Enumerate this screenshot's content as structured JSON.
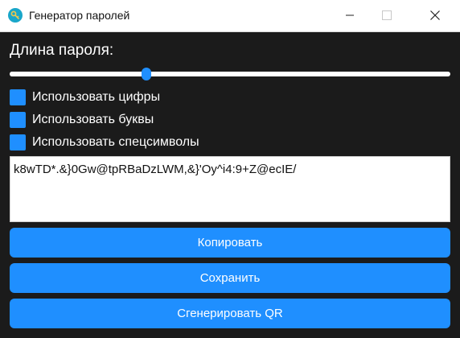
{
  "window": {
    "title": "Генератор паролей",
    "icon": "key-icon",
    "controls": {
      "minimize": "minimize-icon",
      "maximize": "maximize-icon",
      "close": "close-icon"
    }
  },
  "length": {
    "label": "Длина пароля:",
    "slider_fraction": 0.31
  },
  "options": {
    "digits": "Использовать цифры",
    "letters": "Использовать буквы",
    "symbols": "Использовать спецсимволы"
  },
  "password": {
    "value": "k8wTD*.&}0Gw@tpRBaDzLWM,&}'Oy^i4:9+Z@ecIE/"
  },
  "buttons": {
    "copy": "Копировать",
    "save": "Сохранить",
    "qr": "Сгенерировать QR"
  },
  "colors": {
    "accent": "#1f8fff",
    "background": "#1b1b1b"
  }
}
